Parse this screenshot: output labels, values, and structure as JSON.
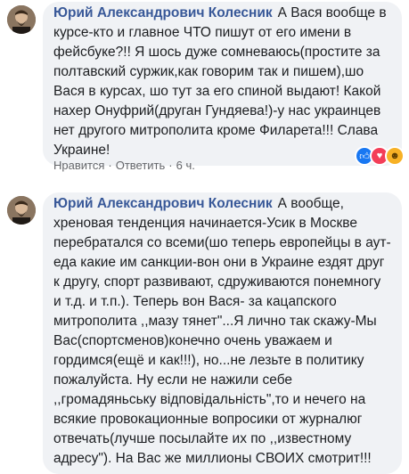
{
  "comments": [
    {
      "author": "Юрий Александрович Колесник",
      "text": "А Вася вообще в курсе-кто и главное ЧТО пишут от его имени в фейсбуке?!! Я шось дуже сомневаюсь(простите за полтавский суржик,как говорим так и пишем),шо Вася в курсах, шо тут за его спиной выдают! Какой нахер Онуфрий(друган Гундяева!)-у нас украинцев нет другого митрополита кроме Филарета!!! Слава Украине!",
      "actions": {
        "like": "Нравится",
        "reply": "Ответить",
        "time": "6 ч."
      },
      "reactions": [
        "like-icon",
        "love-icon",
        "haha-icon"
      ]
    },
    {
      "author": "Юрий Александрович Колесник",
      "text": "А вообще, хреновая тенденция начинается-Усик в Москве перебратался со всеми(шо теперь европейцы в аут-еда какие им санкции-вон они в Украине ездят друг к другу, спорт развивают, сдруживаются понемногу и т.д. и т.п.). Теперь вон Вася- за кацапского митрополита ,,мазу тянет\"...Я лично так скажу-Мы Вас(спортсменов)конечно очень уважаем и гордимся(ещё и как!!!), но...не лезьте в политику пожалуйста. Ну если не нажили себе ,,громадяньську відповідальність\",то и нечего на всякие провокационные вопросики от журналюг отвечать(лучше посылайте их по ,,известному адресу\"). На Вас же миллионы СВОИХ смотрит!!!"
    }
  ]
}
